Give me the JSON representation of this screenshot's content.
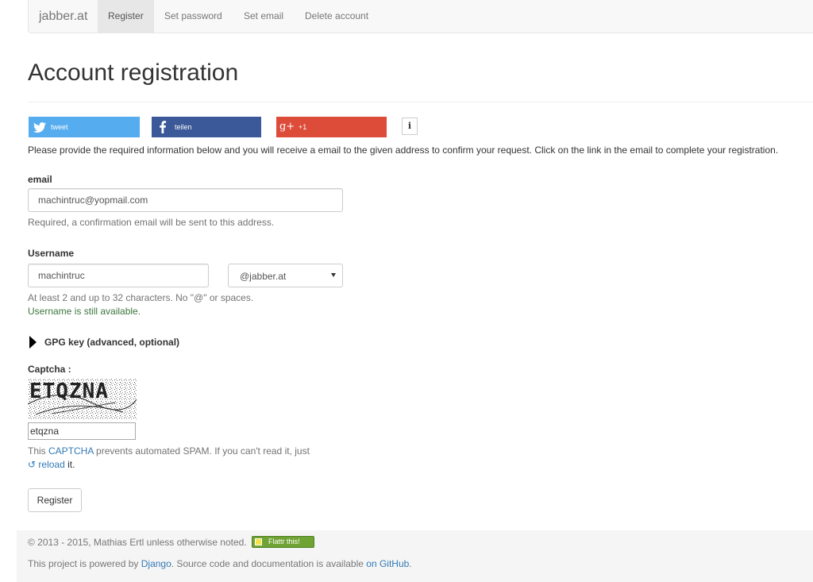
{
  "nav": {
    "brand": "jabber.at",
    "items": [
      {
        "label": "Register",
        "active": true
      },
      {
        "label": "Set password",
        "active": false
      },
      {
        "label": "Set email",
        "active": false
      },
      {
        "label": "Delete account",
        "active": false
      }
    ]
  },
  "page": {
    "title": "Account registration"
  },
  "share": {
    "twitter": {
      "label": "tweet",
      "icon": "twitter-bird-icon",
      "color": "#55acee"
    },
    "facebook": {
      "label": "teilen",
      "icon": "facebook-f-icon",
      "color": "#3b5998"
    },
    "gplus": {
      "label": "+1",
      "icon_text": "g+",
      "icon": "google-plus-icon",
      "color": "#dd4b39"
    },
    "info": {
      "label": "i",
      "icon": "info-icon"
    }
  },
  "intro": "Please provide the required information below and you will receive a email to the given address to confirm your request. Click on the link in the email to complete your registration.",
  "email": {
    "label": "email",
    "value": "machintruc@yopmail.com",
    "help": "Required, a confirmation email will be sent to this address."
  },
  "username": {
    "label": "Username",
    "value": "machintruc",
    "domain": "@jabber.at",
    "help": "At least 2 and up to 32 characters. No \"@\" or spaces.",
    "status": "Username is still available.",
    "status_color": "#3c763d"
  },
  "gpg": {
    "label": "GPG key (advanced, optional)"
  },
  "captcha": {
    "label": "Captcha :",
    "image_text": "ETQZNA",
    "value": "etqzna",
    "help_prefix": "This ",
    "help_link": "CAPTCHA",
    "help_suffix": " prevents automated SPAM. If you can't read it, just",
    "reload_icon": "↺",
    "reload_link": "reload",
    "reload_suffix": " it."
  },
  "register_button": "Register",
  "footer": {
    "copyright": "© 2013 - 2015, Mathias Ertl unless otherwise noted.",
    "flattr": "Flattr this!",
    "powered_prefix": "This project is powered by ",
    "django_link": "Django",
    "powered_middle": ". Source code and documentation is available ",
    "github_link": "on GitHub",
    "powered_suffix": "."
  },
  "colors": {
    "link": "#337ab7",
    "help": "#737373",
    "success": "#3c763d"
  }
}
